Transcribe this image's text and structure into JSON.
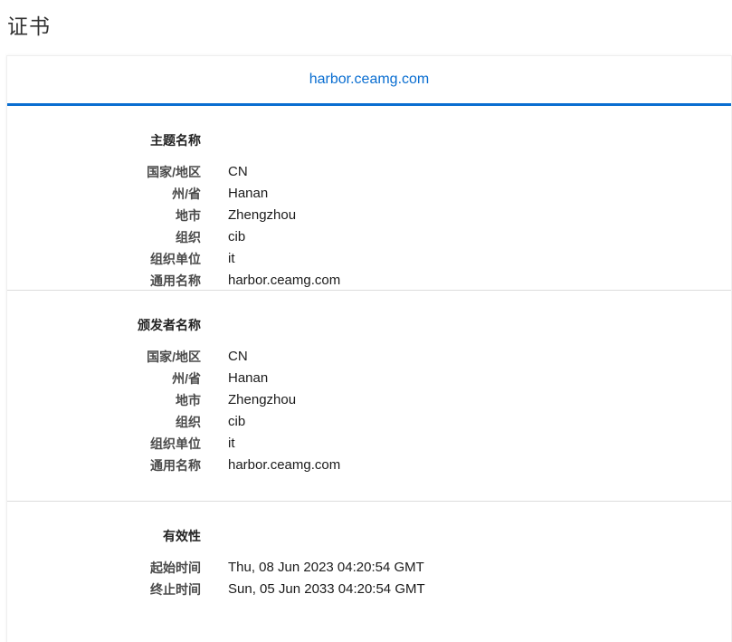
{
  "page": {
    "title": "证书"
  },
  "tabs": [
    {
      "label": "harbor.ceamg.com",
      "selected": true
    }
  ],
  "subject": {
    "title": "主题名称",
    "fields": [
      {
        "label": "国家/地区",
        "value": "CN"
      },
      {
        "label": "州/省",
        "value": "Hanan"
      },
      {
        "label": "地市",
        "value": "Zhengzhou"
      },
      {
        "label": "组织",
        "value": "cib"
      },
      {
        "label": "组织单位",
        "value": "it"
      },
      {
        "label": "通用名称",
        "value": "harbor.ceamg.com"
      }
    ]
  },
  "issuer": {
    "title": "颁发者名称",
    "fields": [
      {
        "label": "国家/地区",
        "value": "CN"
      },
      {
        "label": "州/省",
        "value": "Hanan"
      },
      {
        "label": "地市",
        "value": "Zhengzhou"
      },
      {
        "label": "组织",
        "value": "cib"
      },
      {
        "label": "组织单位",
        "value": "it"
      },
      {
        "label": "通用名称",
        "value": "harbor.ceamg.com"
      }
    ]
  },
  "validity": {
    "title": "有效性",
    "fields": [
      {
        "label": "起始时间",
        "value": "Thu, 08 Jun 2023 04:20:54 GMT"
      },
      {
        "label": "终止时间",
        "value": "Sun, 05 Jun 2033 04:20:54 GMT"
      }
    ]
  },
  "colors": {
    "accent": "#0a6ed1",
    "divider": "#dcdcdc"
  }
}
